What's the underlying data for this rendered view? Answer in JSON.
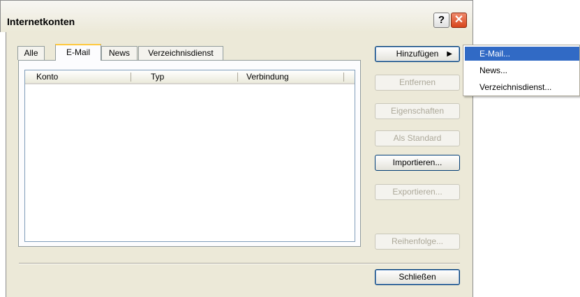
{
  "window": {
    "title": "Internetkonten"
  },
  "titlebar": {
    "help_glyph": "?",
    "close_glyph": "✕"
  },
  "tabs": [
    {
      "label": "Alle"
    },
    {
      "label": "E-Mail"
    },
    {
      "label": "News"
    },
    {
      "label": "Verzeichnisdienst"
    }
  ],
  "active_tab": "E-Mail",
  "list": {
    "columns": [
      {
        "label": "Konto"
      },
      {
        "label": "Typ"
      },
      {
        "label": "Verbindung"
      }
    ],
    "rows": []
  },
  "buttons": {
    "add": "Hinzufügen",
    "remove": "Entfernen",
    "properties": "Eigenschaften",
    "default": "Als Standard",
    "import": "Importieren...",
    "export": "Exportieren...",
    "order": "Reihenfolge...",
    "close": "Schließen"
  },
  "submenu": {
    "items": [
      {
        "label": "E-Mail..."
      },
      {
        "label": "News..."
      },
      {
        "label": "Verzeichnisdienst..."
      }
    ],
    "highlighted": "E-Mail..."
  },
  "colors": {
    "accent": "#316ac5",
    "tab_highlight": "#ffc83c",
    "face": "#ece9d8"
  }
}
